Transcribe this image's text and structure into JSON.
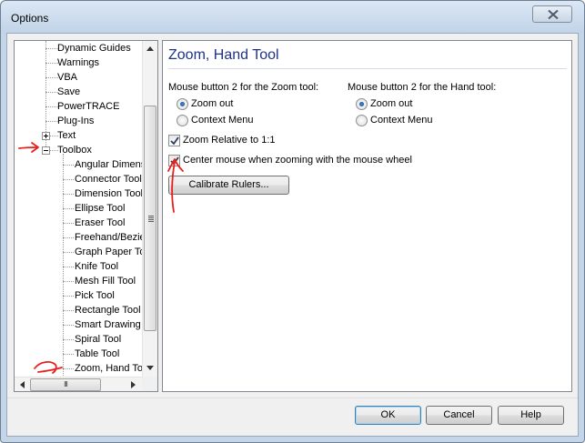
{
  "window": {
    "title": "Options"
  },
  "tree": {
    "items": [
      {
        "label": "Dynamic Guides"
      },
      {
        "label": "Warnings"
      },
      {
        "label": "VBA"
      },
      {
        "label": "Save"
      },
      {
        "label": "PowerTRACE"
      },
      {
        "label": "Plug-Ins"
      },
      {
        "label": "Text"
      },
      {
        "label": "Toolbox"
      },
      {
        "label": "Angular Dimension Tool"
      },
      {
        "label": "Connector Tool"
      },
      {
        "label": "Dimension Tool"
      },
      {
        "label": "Ellipse Tool"
      },
      {
        "label": "Eraser Tool"
      },
      {
        "label": "Freehand/Bezier Tool"
      },
      {
        "label": "Graph Paper Tool"
      },
      {
        "label": "Knife Tool"
      },
      {
        "label": "Mesh Fill Tool"
      },
      {
        "label": "Pick Tool"
      },
      {
        "label": "Rectangle Tool"
      },
      {
        "label": "Smart Drawing Tool"
      },
      {
        "label": "Spiral Tool"
      },
      {
        "label": "Table Tool"
      },
      {
        "label": "Zoom, Hand Tool"
      }
    ],
    "scroll_grip": "III"
  },
  "panel": {
    "title": "Zoom, Hand Tool",
    "zoom_group_label": "Mouse button 2 for the Zoom tool:",
    "zoom_options": [
      "Zoom out",
      "Context Menu"
    ],
    "zoom_selected": "Zoom out",
    "hand_group_label": "Mouse button 2 for the Hand tool:",
    "hand_options": [
      "Zoom out",
      "Context Menu"
    ],
    "hand_selected": "Zoom out",
    "zoom_relative_label": "Zoom Relative to 1:1",
    "zoom_relative_checked": true,
    "center_mouse_label": "Center mouse when zooming with the mouse wheel",
    "center_mouse_checked": true,
    "calibrate_label": "Calibrate Rulers..."
  },
  "footer": {
    "ok_label": "OK",
    "cancel_label": "Cancel",
    "help_label": "Help"
  },
  "annotation_color": "#e8201c"
}
